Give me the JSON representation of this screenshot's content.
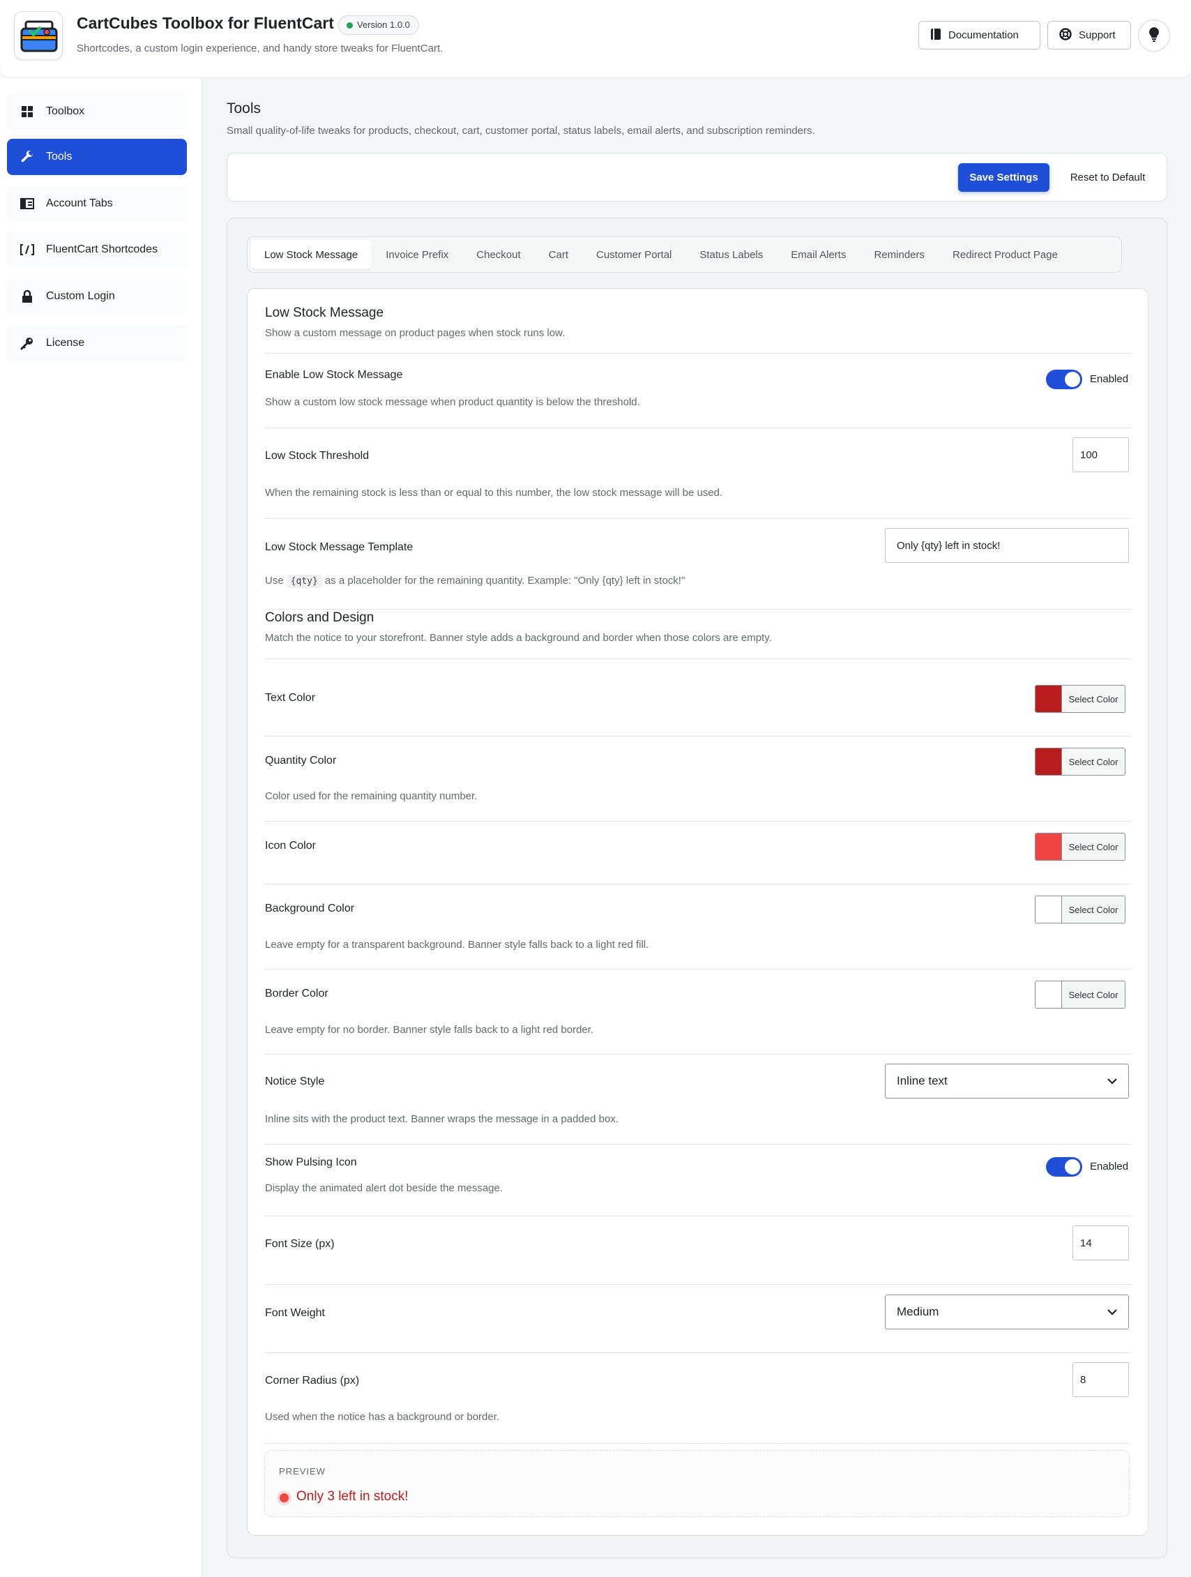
{
  "header": {
    "title": "CartCubes Toolbox for FluentCart",
    "version": "Version 1.0.0",
    "subtitle": "Shortcodes, a custom login experience, and handy store tweaks for FluentCart.",
    "documentation_label": "Documentation",
    "support_label": "Support",
    "logo_icon": "toolbox-icon",
    "bulb_icon": "lightbulb-icon"
  },
  "sidebar": {
    "items": [
      {
        "label": "Toolbox",
        "icon": "grid-icon",
        "active": false
      },
      {
        "label": "Tools",
        "icon": "wrench-icon",
        "active": true
      },
      {
        "label": "Account Tabs",
        "icon": "tabs-icon",
        "active": false
      },
      {
        "label": "FluentCart Shortcodes",
        "icon": "shortcode-icon",
        "active": false
      },
      {
        "label": "Custom Login",
        "icon": "lock-icon",
        "active": false
      },
      {
        "label": "License",
        "icon": "key-icon",
        "active": false
      }
    ]
  },
  "page": {
    "title": "Tools",
    "description": "Small quality-of-life tweaks for products, checkout, cart, customer portal, status labels, email alerts, and subscription reminders.",
    "save_label": "Save Settings",
    "reset_label": "Reset to Default"
  },
  "tabs": [
    {
      "label": "Low Stock Message",
      "active": true
    },
    {
      "label": "Invoice Prefix"
    },
    {
      "label": "Checkout"
    },
    {
      "label": "Cart"
    },
    {
      "label": "Customer Portal"
    },
    {
      "label": "Status Labels"
    },
    {
      "label": "Email Alerts"
    },
    {
      "label": "Reminders"
    },
    {
      "label": "Redirect Product Page"
    }
  ],
  "low_stock": {
    "title": "Low Stock Message",
    "description": "Show a custom message on product pages when stock runs low.",
    "enable": {
      "label": "Enable Low Stock Message",
      "state": "Enabled",
      "on": true,
      "help": "Show a custom low stock message when product quantity is below the threshold."
    },
    "threshold": {
      "label": "Low Stock Threshold",
      "value": "100",
      "help": "When the remaining stock is less than or equal to this number, the low stock message will be used."
    },
    "template": {
      "label": "Low Stock Message Template",
      "value": "Only {qty} left in stock!",
      "help_prefix": "Use",
      "help_code": "{qty}",
      "help_suffix": "as a placeholder for the remaining quantity. Example: \"Only {qty} left in stock!\""
    }
  },
  "design": {
    "title": "Colors and Design",
    "description": "Match the notice to your storefront. Banner style adds a background and border when those colors are empty.",
    "select_color_label": "Select Color",
    "text_color": {
      "label": "Text Color",
      "color": "#b91c1c"
    },
    "quantity_color": {
      "label": "Quantity Color",
      "color": "#b91c1c",
      "help": "Color used for the remaining quantity number."
    },
    "icon_color": {
      "label": "Icon Color",
      "color": "#ef4444"
    },
    "background_color": {
      "label": "Background Color",
      "color": "#ffffff",
      "help": "Leave empty for a transparent background. Banner style falls back to a light red fill."
    },
    "border_color": {
      "label": "Border Color",
      "color": "#ffffff",
      "help": "Leave empty for no border. Banner style falls back to a light red border."
    },
    "notice_style": {
      "label": "Notice Style",
      "value": "Inline text",
      "help": "Inline sits with the product text. Banner wraps the message in a padded box."
    },
    "pulsing_icon": {
      "label": "Show Pulsing Icon",
      "state": "Enabled",
      "on": true,
      "help": "Display the animated alert dot beside the message."
    },
    "font_size": {
      "label": "Font Size (px)",
      "value": "14"
    },
    "font_weight": {
      "label": "Font Weight",
      "value": "Medium"
    },
    "corner_radius": {
      "label": "Corner Radius (px)",
      "value": "8",
      "help": "Used when the notice has a background or border."
    }
  },
  "preview": {
    "label": "PREVIEW",
    "message": "Only 3 left in stock!"
  }
}
